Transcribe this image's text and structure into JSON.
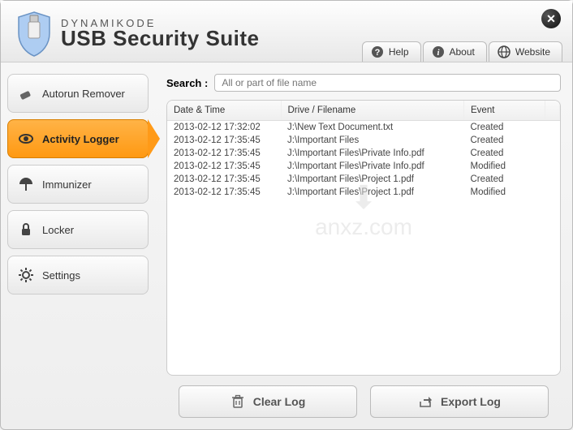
{
  "brand": {
    "small": "DYNAMIKODE",
    "title": "USB Security Suite"
  },
  "header_tabs": {
    "help": "Help",
    "about": "About",
    "website": "Website"
  },
  "sidebar": {
    "items": [
      {
        "label": "Autorun Remover"
      },
      {
        "label": "Activity Logger"
      },
      {
        "label": "Immunizer"
      },
      {
        "label": "Locker"
      },
      {
        "label": "Settings"
      }
    ],
    "active_index": 1
  },
  "search": {
    "label": "Search :",
    "placeholder": "All or part of file name",
    "value": ""
  },
  "table": {
    "columns": {
      "datetime": "Date & Time",
      "drive": "Drive / Filename",
      "event": "Event"
    },
    "rows": [
      {
        "datetime": "2013-02-12 17:32:02",
        "drive": "J:\\New Text Document.txt",
        "event": "Created"
      },
      {
        "datetime": "2013-02-12 17:35:45",
        "drive": "J:\\Important Files",
        "event": "Created"
      },
      {
        "datetime": "2013-02-12 17:35:45",
        "drive": "J:\\Important Files\\Private Info.pdf",
        "event": "Created"
      },
      {
        "datetime": "2013-02-12 17:35:45",
        "drive": "J:\\Important Files\\Private Info.pdf",
        "event": "Modified"
      },
      {
        "datetime": "2013-02-12 17:35:45",
        "drive": "J:\\Important Files\\Project 1.pdf",
        "event": "Created"
      },
      {
        "datetime": "2013-02-12 17:35:45",
        "drive": "J:\\Important Files\\Project 1.pdf",
        "event": "Modified"
      }
    ]
  },
  "footer": {
    "clear": "Clear Log",
    "export": "Export Log"
  },
  "watermark": {
    "text": "anxz.com"
  }
}
